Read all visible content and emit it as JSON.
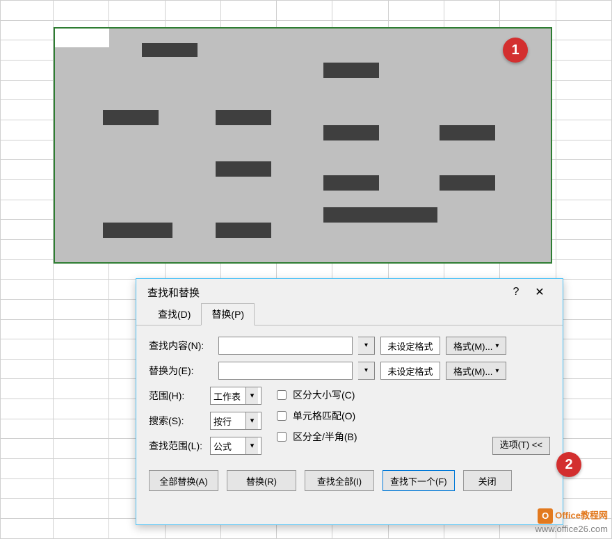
{
  "annotations": {
    "badge1": "1",
    "badge2": "2"
  },
  "dialog": {
    "title": "查找和替换",
    "help": "?",
    "tabs": {
      "find": "查找(D)",
      "replace": "替换(P)"
    },
    "find_label": "查找内容(N):",
    "replace_label": "替换为(E):",
    "find_value": "",
    "replace_value": "",
    "no_format": "未设定格式",
    "format_btn": "格式(M)...",
    "scope_label": "范围(H):",
    "scope_value": "工作表",
    "search_label": "搜索(S):",
    "search_value": "按行",
    "lookin_label": "查找范围(L):",
    "lookin_value": "公式",
    "match_case": "区分大小写(C)",
    "match_cell": "单元格匹配(O)",
    "match_width": "区分全/半角(B)",
    "options_btn": "选项(T) <<",
    "btn_replace_all": "全部替换(A)",
    "btn_replace": "替换(R)",
    "btn_find_all": "查找全部(I)",
    "btn_find_next": "查找下一个(F)",
    "btn_close": "关闭"
  },
  "watermark": {
    "line1": "Office教程网",
    "line2": "www.office26.com"
  }
}
